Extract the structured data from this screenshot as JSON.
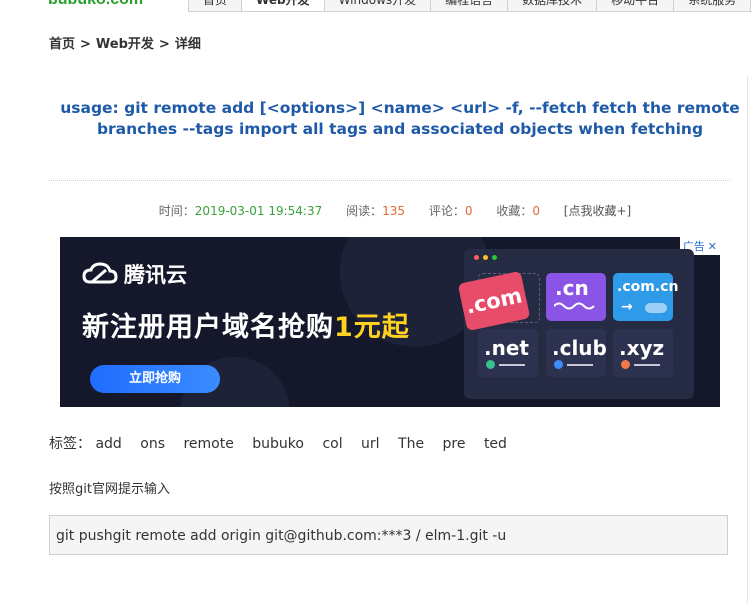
{
  "site": {
    "logo": "bubuko.com"
  },
  "nav": {
    "tabs": [
      {
        "label": "首页",
        "active": false
      },
      {
        "label": "Web开发",
        "active": true
      },
      {
        "label": "Windows开发",
        "active": false
      },
      {
        "label": "编程语言",
        "active": false
      },
      {
        "label": "数据库技术",
        "active": false
      },
      {
        "label": "移动平台",
        "active": false
      },
      {
        "label": "系统服务",
        "active": false
      }
    ]
  },
  "breadcrumb": {
    "items": [
      "首页",
      "Web开发",
      "详细"
    ],
    "separator": ">"
  },
  "article": {
    "title": "usage: git remote add [<options>] <name> <url> -f, --fetch fetch the remote branches --tags import all tags and associated objects when fetching",
    "meta": {
      "time_label": "时间：",
      "time": "2019-03-01 19:54:37",
      "read_label": "阅读：",
      "reads": "135",
      "comment_label": "评论：",
      "comments": "0",
      "fav_label": "收藏：",
      "favorites": "0",
      "fav_link": "[点我收藏+]"
    },
    "tags_label": "标签：",
    "tags": [
      "add",
      "ons",
      "remote",
      "bubuko",
      "col",
      "url",
      "The",
      "pre",
      "ted"
    ],
    "body": "按照git官网提示输入",
    "code": "git pushgit remote add origin git@github.com:***3 / elm-1.git -u"
  },
  "ad": {
    "badge": "广告",
    "close": "✕",
    "brand": "腾讯云",
    "headline": "新注册用户域名抢购",
    "headline_accent": "1元起",
    "cta": "立即抢购",
    "domains": [
      ".com",
      ".cn",
      ".com.cn",
      ".net",
      ".club",
      ".xyz"
    ],
    "colors": {
      "bg": "#15182a",
      "accent": "#ffd21f",
      "cn": "#8a55e6",
      "comcn": "#2f9be8",
      "com": "#e84c6b"
    }
  }
}
